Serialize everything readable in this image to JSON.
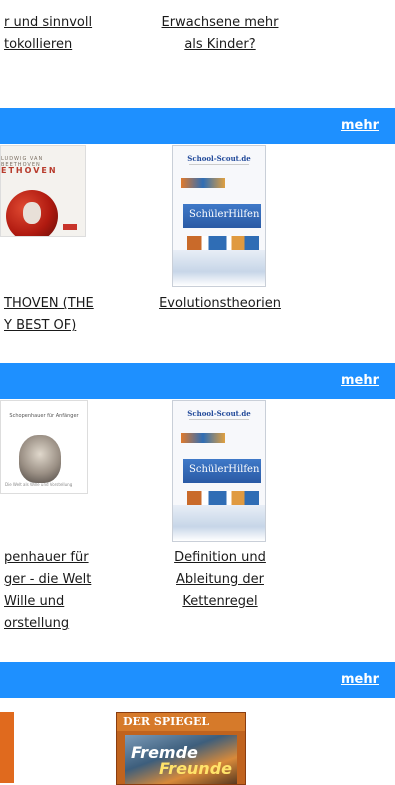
{
  "top": {
    "left_title_lines": [
      "r und sinnvoll",
      "tokollieren"
    ],
    "right_title_lines": [
      "Erwachsene mehr",
      "als Kinder?"
    ]
  },
  "sections": [
    {
      "more_label": "mehr",
      "items": [
        {
          "cover_type": "beethoven",
          "cover_text": [
            "LUDWIG VAN BEETHOVEN",
            "ETHOVEN"
          ],
          "title_lines": [
            "THOVEN (THE",
            "Y BEST OF)"
          ]
        },
        {
          "cover_type": "school-scout",
          "cover_text": [
            "School-Scout.de",
            "SchülerHilfen"
          ],
          "title_lines": [
            "Evolutionstheorien"
          ]
        }
      ]
    },
    {
      "more_label": "mehr",
      "items": [
        {
          "cover_type": "schopenhauer",
          "cover_text": [
            "Schopenhauer für Anfänger",
            "Die Welt als Wille und Vorstellung"
          ],
          "title_lines": [
            "penhauer für",
            "ger - die Welt",
            "Wille und",
            "orstellung"
          ]
        },
        {
          "cover_type": "school-scout",
          "cover_text": [
            "School-Scout.de",
            "SchülerHilfen"
          ],
          "title_lines": [
            "Definition und",
            "Ableitung der",
            "Kettenregel"
          ]
        }
      ]
    },
    {
      "more_label": "mehr",
      "items": [
        {
          "cover_type": "orange-cover",
          "cover_text": [],
          "title_lines": []
        },
        {
          "cover_type": "spiegel",
          "cover_text": [
            "DER SPIEGEL",
            "Fremde",
            "Freunde"
          ],
          "title_lines": []
        }
      ]
    }
  ],
  "colors": {
    "bar": "#1e90ff",
    "link": "#1a1a1a",
    "more": "#ffffff"
  }
}
